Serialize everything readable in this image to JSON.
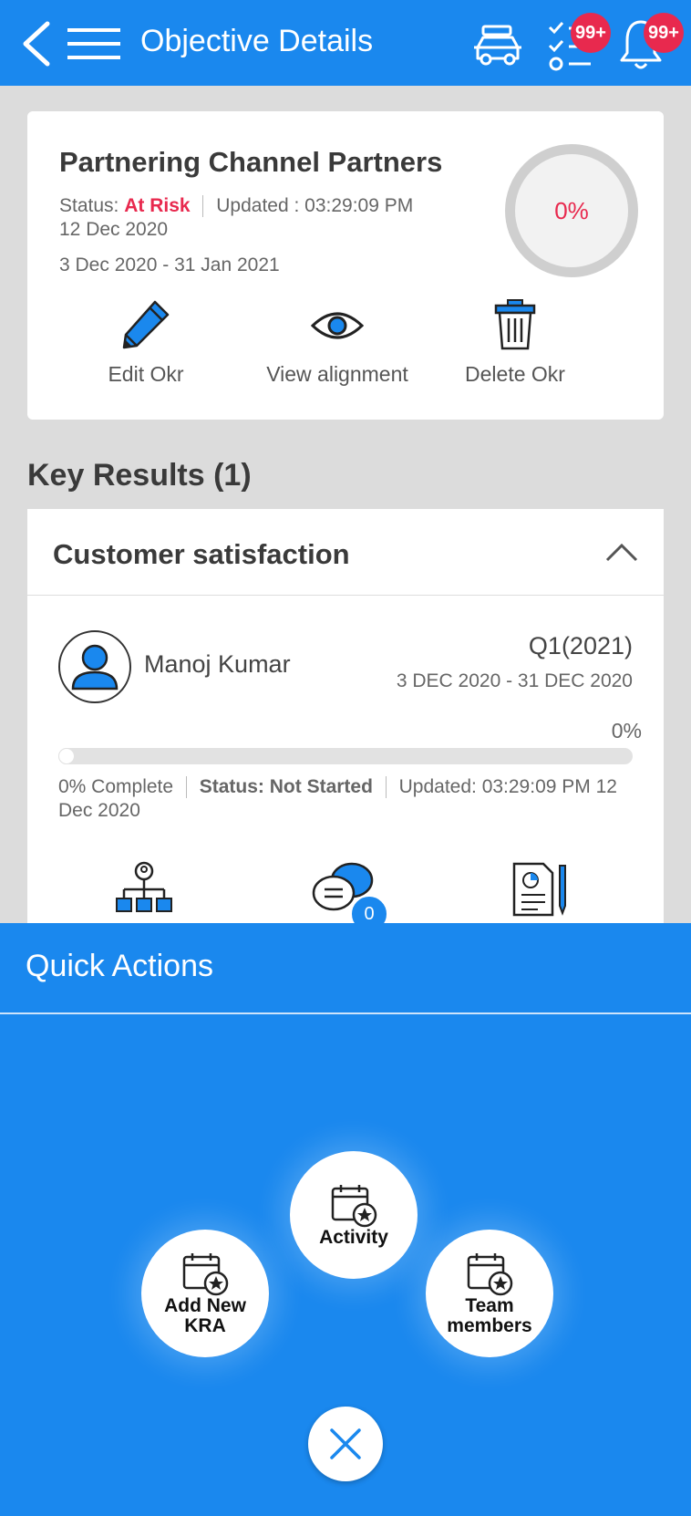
{
  "header": {
    "title": "Objective Details",
    "tasks_badge": "99+",
    "notifications_badge": "99+"
  },
  "objective": {
    "title": "Partnering Channel Partners",
    "status_label": "Status:",
    "status_value": "At Risk",
    "updated_text": "Updated : 03:29:09 PM",
    "updated_date": "12 Dec 2020",
    "date_range": "3 Dec 2020 - 31 Jan 2021",
    "progress_text": "0%",
    "actions": {
      "edit": "Edit Okr",
      "view": "View alignment",
      "delete": "Delete Okr"
    }
  },
  "key_results": {
    "heading": "Key Results (1)",
    "item": {
      "title": "Customer satisfaction",
      "owner": "Manoj Kumar",
      "quarter": "Q1(2021)",
      "date_range": "3 DEC 2020 - 31 DEC 2020",
      "progress_pct_text": "0%",
      "progress_value": 0,
      "complete_text": "0% Complete",
      "status_text": "Status: Not Started",
      "updated_line1": "Updated: 03:29:09 PM 12",
      "updated_line2": "Dec 2020",
      "comments_count": "0"
    }
  },
  "quick_actions": {
    "title": "Quick Actions",
    "items": [
      {
        "label": "Activity"
      },
      {
        "label": "Add New\nKRA"
      },
      {
        "label": "Team\nmembers"
      }
    ]
  },
  "colors": {
    "primary": "#1a88ee",
    "danger": "#e8294e",
    "background": "#dcdcdc"
  }
}
